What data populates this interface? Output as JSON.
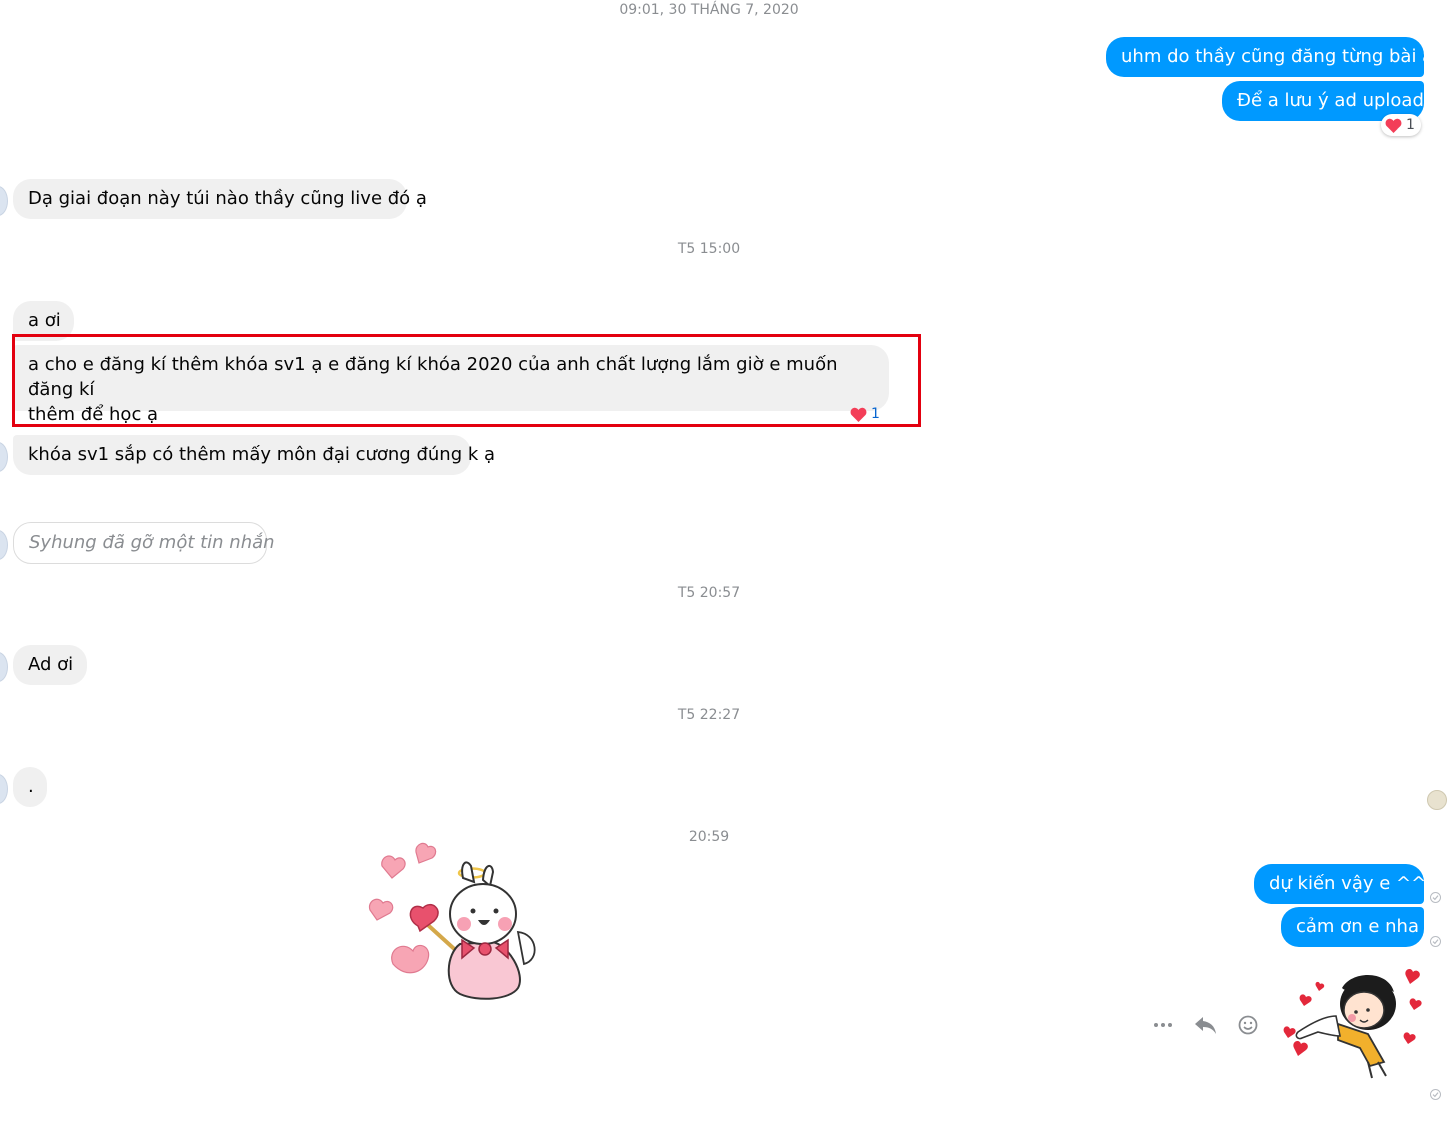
{
  "timestamps": {
    "t1": "09:01, 30 THÁNG 7, 2020",
    "t2": "T5 15:00",
    "t3": "T5 20:57",
    "t4": "T5 22:27",
    "t5": "20:59"
  },
  "messages": {
    "out_1": "uhm do thầy cũng đăng từng bài á",
    "out_2": "Để a lưu ý ad upload",
    "in_1": "Dạ giai đoạn này túi nào thầy cũng live đó ạ",
    "in_2": "a ơi",
    "in_3_line1": "a cho e đăng kí thêm khóa sv1 ạ e đăng kí khóa 2020 của anh chất lượng lắm giờ e muốn đăng kí",
    "in_3_line2": "thêm để học ạ",
    "in_4": "khóa sv1 sắp có thêm mấy môn đại cương đúng k ạ",
    "removed": "Syhung đã gỡ một tin nhắn",
    "in_5": "Ad ơi",
    "in_6": ".",
    "out_3": "dự kiến vậy e ^^",
    "out_4": "cảm ơn e nha"
  },
  "reactions": {
    "out_2": {
      "emoji": "heart",
      "count": "1"
    },
    "in_3": {
      "emoji": "heart",
      "count": "1"
    }
  },
  "colors": {
    "outgoing": "#0099ff",
    "incoming": "#f0f0f0",
    "highlight": "#e3000f",
    "heart": "#f33e58"
  },
  "icons": [
    "more-options-icon",
    "reply-icon",
    "emoji-reaction-icon",
    "seen-check-icon",
    "heart-icon"
  ]
}
